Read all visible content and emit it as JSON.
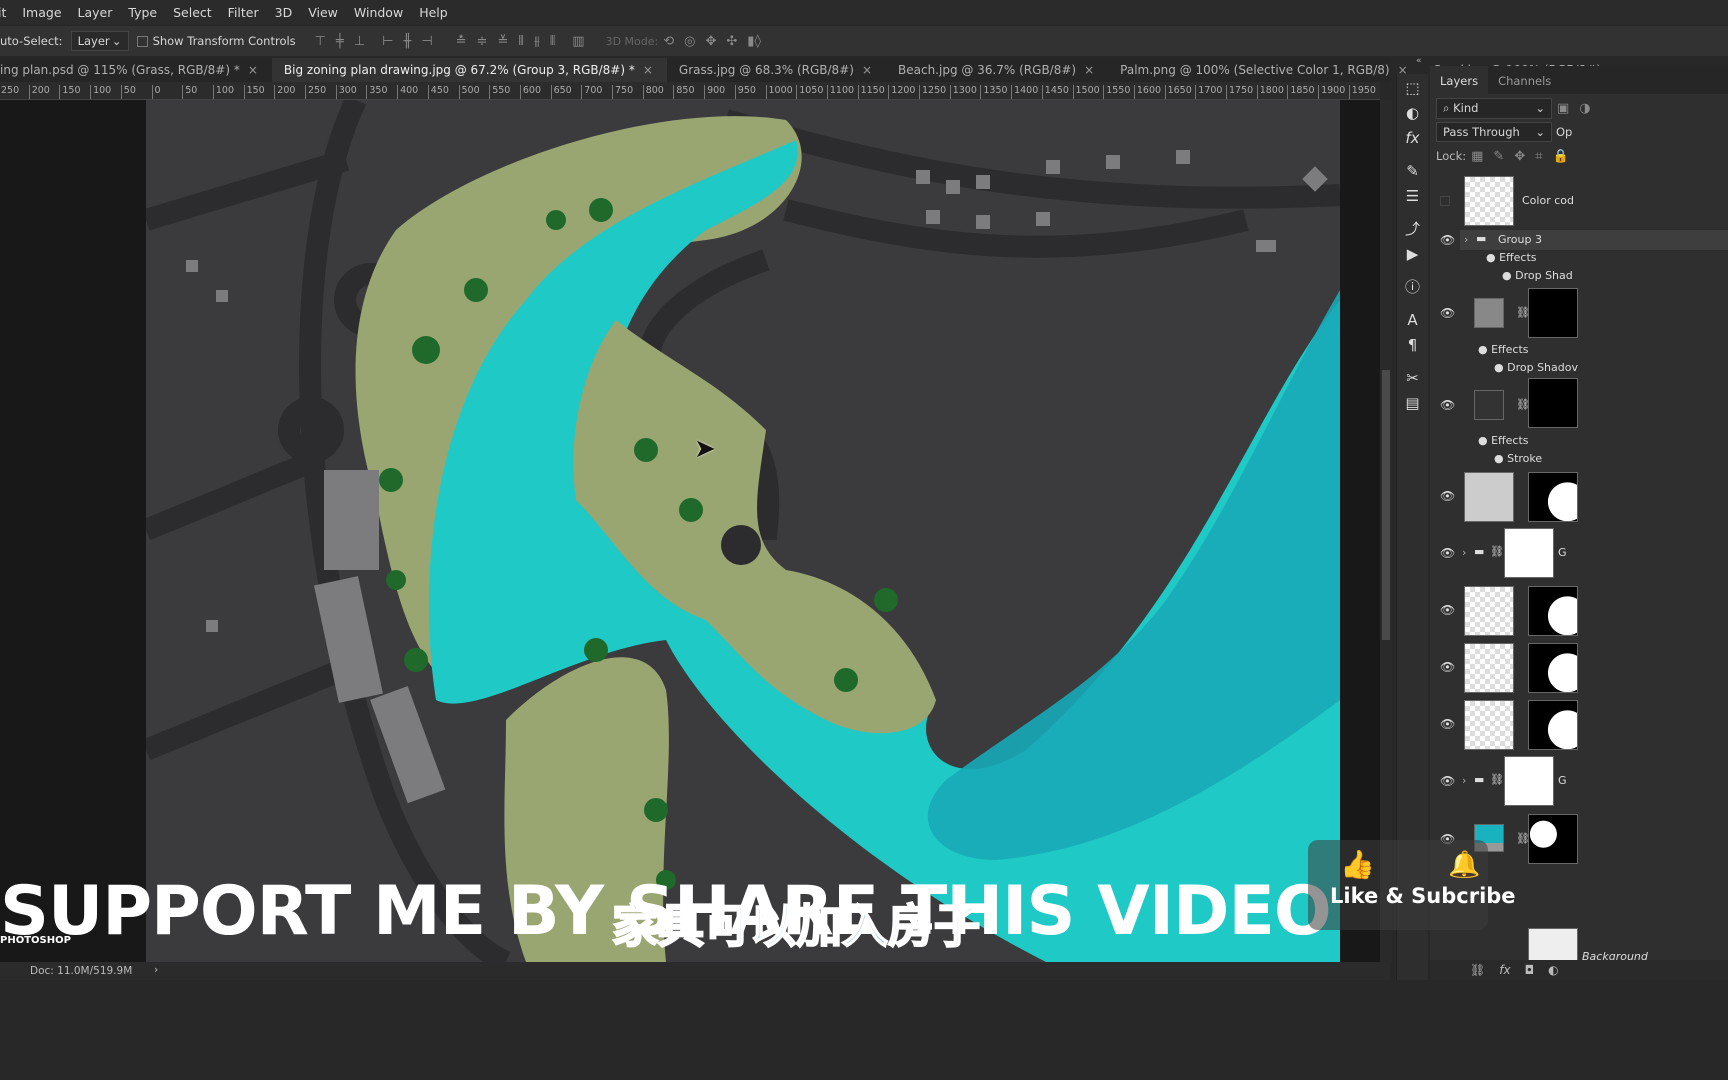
{
  "menu": [
    "it",
    "Image",
    "Layer",
    "Type",
    "Select",
    "Filter",
    "3D",
    "View",
    "Window",
    "Help"
  ],
  "options": {
    "auto_select_label": "uto-Select:",
    "auto_select_value": "Layer",
    "show_transform": "Show Transform Controls",
    "mode_3d": "3D Mode:"
  },
  "tabs": [
    {
      "label": "ing plan.psd @ 115% (Grass, RGB/8#) *",
      "active": false
    },
    {
      "label": "Big zoning plan drawing.jpg @ 67.2% (Group 3, RGB/8#) *",
      "active": true
    },
    {
      "label": "Grass.jpg @ 68.3% (RGB/8#)",
      "active": false
    },
    {
      "label": "Beach.jpg @ 36.7% (RGB/8#)",
      "active": false
    },
    {
      "label": "Palm.png @ 100% (Selective Color 1, RGB/8)",
      "active": false
    },
    {
      "label": "Sand.jpg @ 100% (RGB/8#)",
      "active": false
    }
  ],
  "tab_close": "×",
  "ruler": [
    "250",
    "200",
    "150",
    "100",
    "50",
    "0",
    "50",
    "100",
    "150",
    "200",
    "250",
    "300",
    "350",
    "400",
    "450",
    "500",
    "550",
    "600",
    "650",
    "700",
    "750",
    "800",
    "850",
    "900",
    "950",
    "1000",
    "1050",
    "1100",
    "1150",
    "1200",
    "1250",
    "1300",
    "1350",
    "1400",
    "1450",
    "1500",
    "1550",
    "1600",
    "1650",
    "1700",
    "1750",
    "1800",
    "1850",
    "1900",
    "1950",
    "20"
  ],
  "status": {
    "doc": "Doc: 11.0M/519.9M"
  },
  "panel": {
    "tabs": [
      "Layers",
      "Channels"
    ],
    "kind": "Kind",
    "blend": "Pass Through",
    "opacity_label": "Op",
    "lock_label": "Lock:",
    "layers": [
      {
        "name": "Color cod",
        "visible": false
      },
      {
        "name": "Group 3",
        "selected": true
      },
      {
        "name": "Effects"
      },
      {
        "name": "Drop Shad"
      },
      {
        "name": "Effects"
      },
      {
        "name": "Drop Shadov"
      },
      {
        "name": "Effects"
      },
      {
        "name": "Stroke"
      },
      {
        "name": "G"
      },
      {
        "name": "G"
      },
      {
        "name": "Background"
      }
    ]
  },
  "overlay": {
    "support": "SUPPORT ME BY SHARE THIS VIDEO",
    "brand": "PHOTOSHOP",
    "subtitle": "家具可以加入房子",
    "like": "Like & Subcribe"
  },
  "colors": {
    "water": "#19b3c0",
    "water_bright": "#22e0cf",
    "land": "#3b3b3d",
    "grass": "#9aa672",
    "accent_blue": "#2e6fc4"
  }
}
